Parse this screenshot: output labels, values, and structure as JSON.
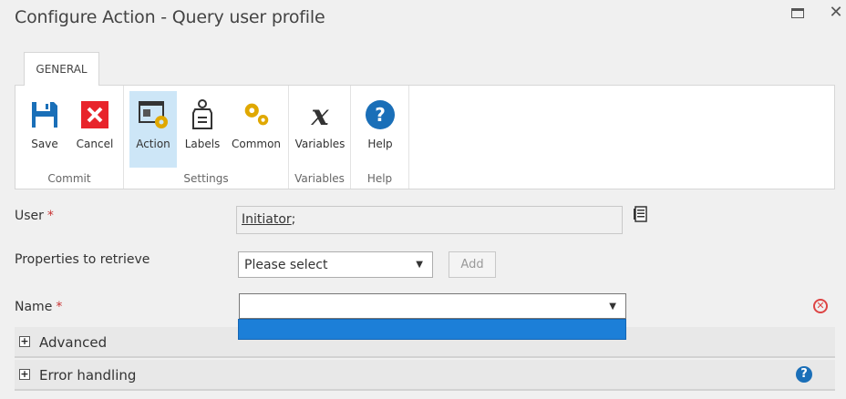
{
  "window": {
    "title": "Configure Action - Query user profile"
  },
  "tabs": [
    {
      "label": "GENERAL"
    }
  ],
  "ribbon": {
    "groups": [
      {
        "label": "Commit",
        "buttons": [
          {
            "label": "Save",
            "icon": "save-icon"
          },
          {
            "label": "Cancel",
            "icon": "cancel-icon"
          }
        ]
      },
      {
        "label": "Settings",
        "buttons": [
          {
            "label": "Action",
            "icon": "action-settings-icon",
            "active": true
          },
          {
            "label": "Labels",
            "icon": "label-tag-icon"
          },
          {
            "label": "Common",
            "icon": "gears-icon"
          }
        ]
      },
      {
        "label": "Variables",
        "buttons": [
          {
            "label": "Variables",
            "icon": "variable-x-icon"
          }
        ]
      },
      {
        "label": "Help",
        "buttons": [
          {
            "label": "Help",
            "icon": "help-icon"
          }
        ]
      }
    ]
  },
  "form": {
    "user": {
      "label": "User",
      "required_mark": "*",
      "value": "Initiator",
      "suffix": ";"
    },
    "properties": {
      "label": "Properties to retrieve",
      "selected": "Please select",
      "add_label": "Add"
    },
    "name": {
      "label": "Name",
      "required_mark": "*",
      "selected": ""
    }
  },
  "sections": [
    {
      "title": "Advanced",
      "expand_symbol": "+"
    },
    {
      "title": "Error handling",
      "expand_symbol": "+"
    }
  ],
  "colors": {
    "accent": "#1c7fd8",
    "active_button_bg": "#cde6f7",
    "required": "#c83232",
    "help_blue": "#1a6fb8"
  }
}
